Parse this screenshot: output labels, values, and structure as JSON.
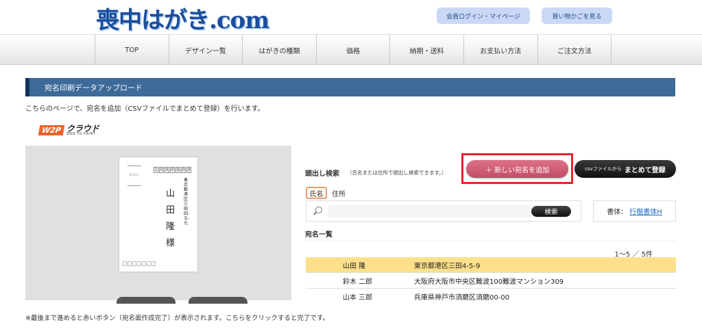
{
  "header": {
    "logo": "喪中はがき.com",
    "login_button": "会員ログイン・マイページ",
    "cart_button": "買い物かごを見る"
  },
  "nav": {
    "items": [
      {
        "label": "TOP"
      },
      {
        "label": "デザイン一覧"
      },
      {
        "label": "はがきの種類"
      },
      {
        "label": "価格"
      },
      {
        "label": "納期・送料"
      },
      {
        "label": "お支払い方法"
      },
      {
        "label": "ご注文方法"
      }
    ]
  },
  "section": {
    "title": "宛名印刷データアップロード",
    "intro": "こちらのページで、宛名を追加（CSVファイルでまとめて登録）を行います。"
  },
  "w2p": {
    "badge": "W2P",
    "name": "クラウド",
    "sub": "WEB TO PRINT"
  },
  "preview": {
    "mihon": "みほん",
    "zip": [
      "1",
      "0",
      "0",
      "0",
      "0",
      "0",
      "0"
    ],
    "address": "東京都港区三田四-五-九",
    "name": "山田隆様"
  },
  "search": {
    "label": "頭出し検索",
    "note": "（氏名または住所で頭出し検索できます。）",
    "tab_name": "氏名",
    "tab_address": "住所",
    "input_value": "",
    "button": "検索"
  },
  "actions": {
    "add_new": "＋ 新しい宛名を追加",
    "csv_small": "csvファイルから",
    "csv_large": "まとめて登録"
  },
  "font": {
    "label": "書体：",
    "value": "行楷書体H"
  },
  "list": {
    "label": "宛名一覧",
    "count": "1〜5 ／ 5件",
    "rows": [
      {
        "name": "山田 隆",
        "address": "東京都港区三田4-5-9"
      },
      {
        "name": "鈴木 二郎",
        "address": "大阪府大阪市中央区難波100難波マンション309"
      },
      {
        "name": "山本 三郎",
        "address": "兵庫県神戸市須磨区須磨00-00"
      }
    ]
  },
  "footer_note": "※最後まで進めると赤いボタン（宛名面作成完了）が表示されます。こちらをクリックすると完了です。",
  "colors": {
    "accent": "#3d6a98",
    "highlight": "#e8242a",
    "add_button": "#c24c66",
    "selected_row": "#fce08a"
  }
}
